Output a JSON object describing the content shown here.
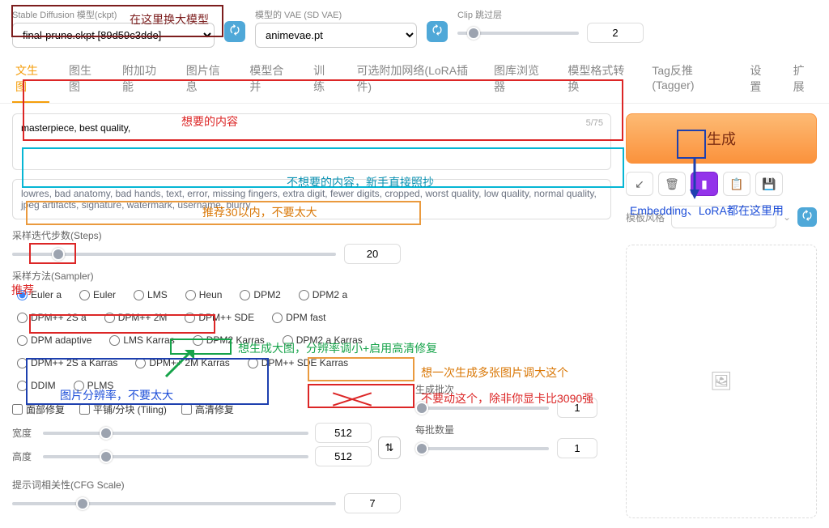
{
  "top": {
    "ckpt_label": "Stable Diffusion 模型(ckpt)",
    "ckpt_value": "final-prune.ckpt [89d59c3dde]",
    "vae_label": "模型的 VAE (SD VAE)",
    "vae_value": "animevae.pt",
    "clip_label": "Clip 跳过层",
    "clip_value": "2"
  },
  "tabs": [
    "文生图",
    "图生图",
    "附加功能",
    "图片信息",
    "模型合并",
    "训练",
    "可选附加网络(LoRA插件)",
    "图库浏览器",
    "模型格式转换",
    "Tag反推(Tagger)",
    "设置",
    "扩展"
  ],
  "prompts": {
    "positive": "masterpiece, best quality,",
    "token_count": "5/75",
    "negative": "lowres, bad anatomy, bad hands, text, error, missing fingers, extra digit, fewer digits, cropped, worst quality, low quality, normal quality, jpeg artifacts, signature, watermark, username, blurry"
  },
  "steps": {
    "label": "采样迭代步数(Steps)",
    "value": "20"
  },
  "sampler": {
    "label": "采样方法(Sampler)",
    "options": [
      "Euler a",
      "Euler",
      "LMS",
      "Heun",
      "DPM2",
      "DPM2 a",
      "DPM++ 2S a",
      "DPM++ 2M",
      "DPM++ SDE",
      "DPM fast",
      "DPM adaptive",
      "LMS Karras",
      "DPM2 Karras",
      "DPM2 a Karras",
      "DPM++ 2S a Karras",
      "DPM++ 2M Karras",
      "DPM++ SDE Karras",
      "DDIM",
      "PLMS"
    ],
    "selected": "Euler a"
  },
  "checks": {
    "face": "面部修复",
    "tiling": "平铺/分块 (Tiling)",
    "hires": "高清修复"
  },
  "dims": {
    "w_label": "宽度",
    "w_value": "512",
    "h_label": "高度",
    "h_value": "512"
  },
  "batch": {
    "count_label": "生成批次",
    "count_value": "1",
    "size_label": "每批数量",
    "size_value": "1"
  },
  "cfg": {
    "label": "提示词相关性(CFG Scale)",
    "value": "7"
  },
  "right": {
    "generate": "生成",
    "style_label": "模板风格"
  },
  "annotations": {
    "swap_model": "在这里换大模型",
    "prompt_want": "想要的内容",
    "prompt_unwant": "不想要的内容，新手直接照抄",
    "steps_tip": "推荐30以内，不要太大",
    "sampler_tip": "推荐",
    "hires_tip": "想生成大图，分辨率调小+启用高清修复",
    "dims_tip": "图片分辨率，不要太大",
    "batch_count_tip": "想一次生成多张图片调大这个",
    "batch_size_tip": "不要动这个，除非你显卡比3090强",
    "extra_net_tip": "Embedding、LoRA都在这里用"
  }
}
